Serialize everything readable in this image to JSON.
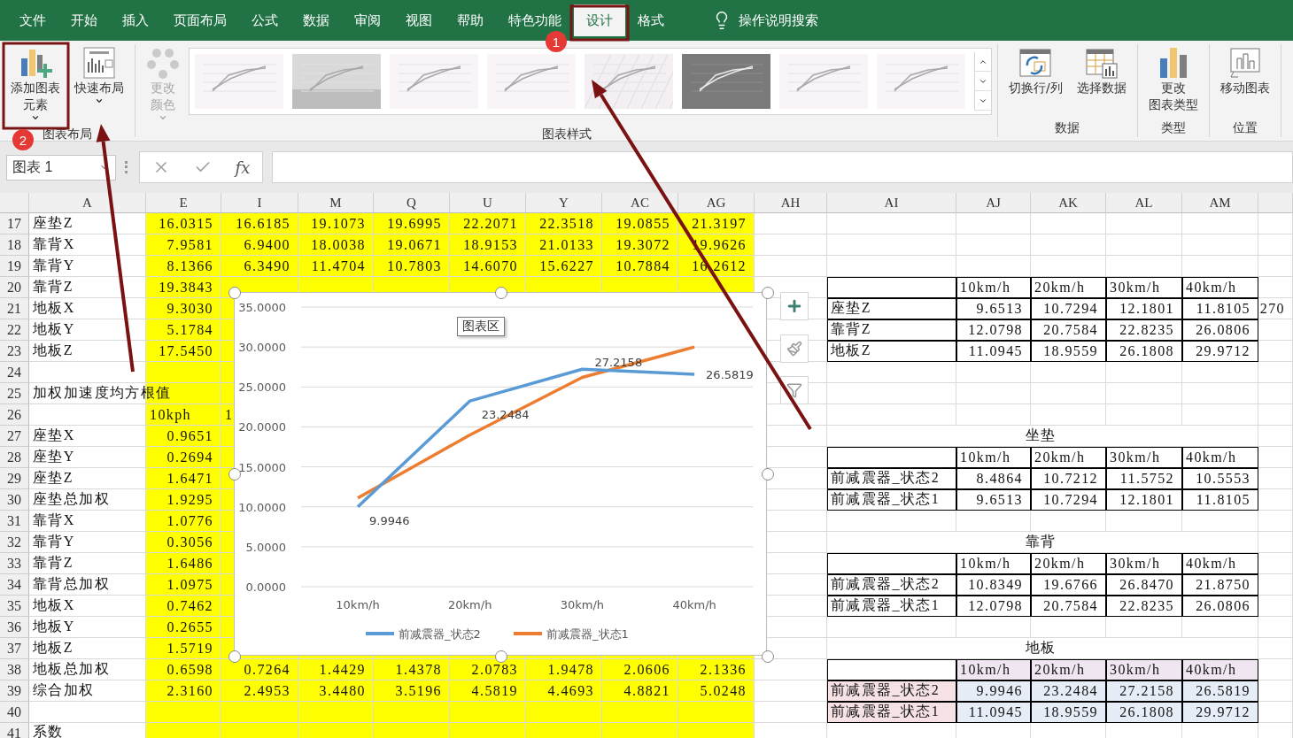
{
  "tabs": [
    {
      "label": "文件",
      "selected": false
    },
    {
      "label": "开始",
      "selected": false
    },
    {
      "label": "插入",
      "selected": false
    },
    {
      "label": "页面布局",
      "selected": false
    },
    {
      "label": "公式",
      "selected": false
    },
    {
      "label": "数据",
      "selected": false
    },
    {
      "label": "审阅",
      "selected": false
    },
    {
      "label": "视图",
      "selected": false
    },
    {
      "label": "帮助",
      "selected": false
    },
    {
      "label": "特色功能",
      "selected": false
    },
    {
      "label": "设计",
      "selected": true
    },
    {
      "label": "格式",
      "selected": false
    }
  ],
  "search": {
    "placeholder": "操作说明搜索"
  },
  "ribbon": {
    "groups": [
      {
        "label": "图表布局",
        "buttons": [
          {
            "kind": "add_element",
            "lines": [
              "添加图表",
              "元素"
            ],
            "dropdown": true,
            "disabled": false
          },
          {
            "kind": "quick_layout",
            "lines": [
              "快速布局"
            ],
            "dropdown": true,
            "disabled": false
          }
        ]
      },
      {
        "label": "图表样式",
        "buttons": [
          {
            "kind": "colors",
            "lines": [
              "更改",
              "颜色"
            ],
            "dropdown": true,
            "disabled": true
          }
        ],
        "gallery": [
          {
            "kind": "plain"
          },
          {
            "kind": "gradient"
          },
          {
            "kind": "plain"
          },
          {
            "kind": "plain"
          },
          {
            "kind": "hatched"
          },
          {
            "kind": "dark"
          },
          {
            "kind": "plain"
          },
          {
            "kind": "plain"
          }
        ]
      },
      {
        "label": "数据",
        "buttons": [
          {
            "kind": "switch",
            "lines": [
              "切换行/列"
            ],
            "dropdown": false,
            "disabled": false
          },
          {
            "kind": "select_data",
            "lines": [
              "选择数据"
            ],
            "dropdown": false,
            "disabled": false
          }
        ]
      },
      {
        "label": "类型",
        "buttons": [
          {
            "kind": "chart_type",
            "lines": [
              "更改",
              "图表类型"
            ],
            "dropdown": false,
            "disabled": false
          }
        ]
      },
      {
        "label": "位置",
        "buttons": [
          {
            "kind": "move",
            "lines": [
              "移动图表"
            ],
            "dropdown": false,
            "disabled": false
          }
        ]
      }
    ]
  },
  "formula_bar": {
    "name_box": "图表 1",
    "function_label": "fx"
  },
  "sheet": {
    "columns": [
      {
        "label": "A",
        "highlighted": false
      },
      {
        "label": "E",
        "highlighted": true
      },
      {
        "label": "I",
        "highlighted": true
      },
      {
        "label": "M",
        "highlighted": true
      },
      {
        "label": "Q",
        "highlighted": true
      },
      {
        "label": "U",
        "highlighted": true
      },
      {
        "label": "Y",
        "highlighted": true
      },
      {
        "label": "AC",
        "highlighted": true
      },
      {
        "label": "AG",
        "highlighted": true
      },
      {
        "label": "AH",
        "highlighted": false
      },
      {
        "label": "AI",
        "highlighted": false
      },
      {
        "label": "AJ",
        "highlighted": false
      },
      {
        "label": "AK",
        "highlighted": false
      },
      {
        "label": "AL",
        "highlighted": false
      },
      {
        "label": "AM",
        "highlighted": false
      },
      {
        "highlighted": false
      }
    ],
    "rows": [
      {
        "number": "17",
        "cells": [
          "座垫Z",
          "16.0315",
          "16.6185",
          "19.1073",
          "19.6995",
          "22.2071",
          "22.3518",
          "19.0855",
          "21.3197"
        ]
      },
      {
        "number": "18",
        "cells": [
          "靠背X",
          "7.9581",
          "6.9400",
          "18.0038",
          "19.0671",
          "18.9153",
          "21.0133",
          "19.3072",
          "19.9626"
        ]
      },
      {
        "number": "19",
        "cells": [
          "靠背Y",
          "8.1366",
          "6.3490",
          "11.4704",
          "10.7803",
          "14.6070",
          "15.6227",
          "10.7884",
          "16.2612"
        ]
      },
      {
        "number": "20",
        "table": true,
        "right_header": true,
        "cells": [
          "靠背Z",
          "19.3843",
          null,
          null,
          null,
          null,
          null,
          null,
          null,
          null,
          null,
          "10km/h",
          "20km/h",
          "30km/h",
          "40km/h"
        ]
      },
      {
        "number": "21",
        "table": true,
        "cells": [
          "地板X",
          "9.3030",
          null,
          null,
          null,
          null,
          null,
          null,
          null,
          null,
          "座垫Z",
          "9.6513",
          "10.7294",
          "12.1801",
          "11.8105",
          "270"
        ]
      },
      {
        "number": "22",
        "table": true,
        "cells": [
          "地板Y",
          "5.1784",
          null,
          null,
          null,
          null,
          null,
          null,
          null,
          null,
          "靠背Z",
          "12.0798",
          "20.7584",
          "22.8235",
          "26.0806"
        ]
      },
      {
        "number": "23",
        "table": true,
        "cells": [
          "地板Z",
          "17.5450",
          null,
          null,
          null,
          null,
          null,
          null,
          null,
          null,
          "地板Z",
          "11.0945",
          "18.9559",
          "26.1808",
          "29.9712"
        ]
      },
      {
        "number": "24",
        "cells": []
      },
      {
        "number": "25",
        "cells": [
          "加权加速度均方根值"
        ]
      },
      {
        "number": "26",
        "left_header": true,
        "cells": [
          null,
          "10kph",
          "1"
        ]
      },
      {
        "number": "27",
        "banner": "坐垫",
        "cells": [
          "座垫X",
          "0.9651"
        ]
      },
      {
        "number": "28",
        "table": true,
        "right_header": true,
        "cells": [
          "座垫Y",
          "0.2694",
          null,
          null,
          null,
          null,
          null,
          null,
          null,
          null,
          null,
          "10km/h",
          "20km/h",
          "30km/h",
          "40km/h"
        ]
      },
      {
        "number": "29",
        "table": true,
        "cells": [
          "座垫Z",
          "1.6471",
          null,
          null,
          null,
          null,
          null,
          null,
          null,
          null,
          "前减震器_状态2",
          "8.4864",
          "10.7212",
          "11.5752",
          "10.5553"
        ]
      },
      {
        "number": "30",
        "table": true,
        "cells": [
          "座垫总加权",
          "1.9295",
          null,
          null,
          null,
          null,
          null,
          null,
          null,
          null,
          "前减震器_状态1",
          "9.6513",
          "10.7294",
          "12.1801",
          "11.8105"
        ]
      },
      {
        "number": "31",
        "cells": [
          "靠背X",
          "1.0776"
        ]
      },
      {
        "number": "32",
        "banner": "靠背",
        "cells": [
          "靠背Y",
          "0.3056"
        ]
      },
      {
        "number": "33",
        "table": true,
        "right_header": true,
        "cells": [
          "靠背Z",
          "1.6486",
          null,
          null,
          null,
          null,
          null,
          null,
          null,
          null,
          null,
          "10km/h",
          "20km/h",
          "30km/h",
          "40km/h"
        ]
      },
      {
        "number": "34",
        "table": true,
        "cells": [
          "靠背总加权",
          "1.0975",
          null,
          null,
          null,
          null,
          null,
          null,
          null,
          null,
          "前减震器_状态2",
          "10.8349",
          "19.6766",
          "26.8470",
          "21.8750"
        ]
      },
      {
        "number": "35",
        "table": true,
        "cells": [
          "地板X",
          "0.7462",
          null,
          null,
          null,
          null,
          null,
          null,
          null,
          null,
          "前减震器_状态1",
          "12.0798",
          "20.7584",
          "22.8235",
          "26.0806"
        ]
      },
      {
        "number": "36",
        "cells": [
          "地板Y",
          "0.2655"
        ]
      },
      {
        "number": "37",
        "banner": "地板",
        "cells": [
          "地板Z",
          "1.5719"
        ]
      },
      {
        "number": "38",
        "table": true,
        "right_header": true,
        "source": true,
        "cells": [
          "地板总加权",
          "0.6598",
          "0.7264",
          "1.4429",
          "1.4378",
          "2.0783",
          "1.9478",
          "2.0606",
          "2.1336",
          null,
          null,
          "10km/h",
          "20km/h",
          "30km/h",
          "40km/h"
        ]
      },
      {
        "number": "39",
        "table": true,
        "source": true,
        "cells": [
          "综合加权",
          "2.3160",
          "2.4953",
          "3.4480",
          "3.5196",
          "4.5819",
          "4.4693",
          "4.8821",
          "5.0248",
          null,
          "前减震器_状态2",
          "9.9946",
          "23.2484",
          "27.2158",
          "26.5819"
        ]
      },
      {
        "number": "40",
        "table": true,
        "source": true,
        "cells": [
          null,
          null,
          null,
          null,
          null,
          null,
          null,
          null,
          null,
          null,
          "前减震器_状态1",
          "11.0945",
          "18.9559",
          "26.1808",
          "29.9712"
        ]
      },
      {
        "number": "41",
        "cells": [
          "系数"
        ]
      }
    ]
  },
  "chart": {
    "tooltip": "图表区",
    "chart_data": {
      "type": "line",
      "categories": [
        "10km/h",
        "20km/h",
        "30km/h",
        "40km/h"
      ],
      "ylim": [
        0,
        35
      ],
      "grid": true,
      "legend": "bottom",
      "yticks": [
        {
          "value": 0,
          "label": "0.0000"
        },
        {
          "value": 5,
          "label": "5.0000"
        },
        {
          "value": 10,
          "label": "10.0000"
        },
        {
          "value": 15,
          "label": "15.0000"
        },
        {
          "value": 20,
          "label": "20.0000"
        },
        {
          "value": 25,
          "label": "25.0000"
        },
        {
          "value": 30,
          "label": "30.0000"
        },
        {
          "value": 35,
          "label": "35.0000"
        }
      ],
      "series": [
        {
          "name": "前减震器_状态2",
          "color": "#5b9bd5",
          "value_labels": [
            "9.9946",
            "23.2484",
            "27.2158",
            "26.5819"
          ],
          "values": [
            9.9946,
            23.2484,
            27.2158,
            26.5819
          ]
        },
        {
          "name": "前减震器_状态1",
          "color": "#ed7d31",
          "values": [
            11.1,
            19.0,
            26.2,
            30.0
          ]
        }
      ]
    }
  },
  "annotations": [
    {
      "label": "1"
    },
    {
      "label": "2"
    }
  ]
}
